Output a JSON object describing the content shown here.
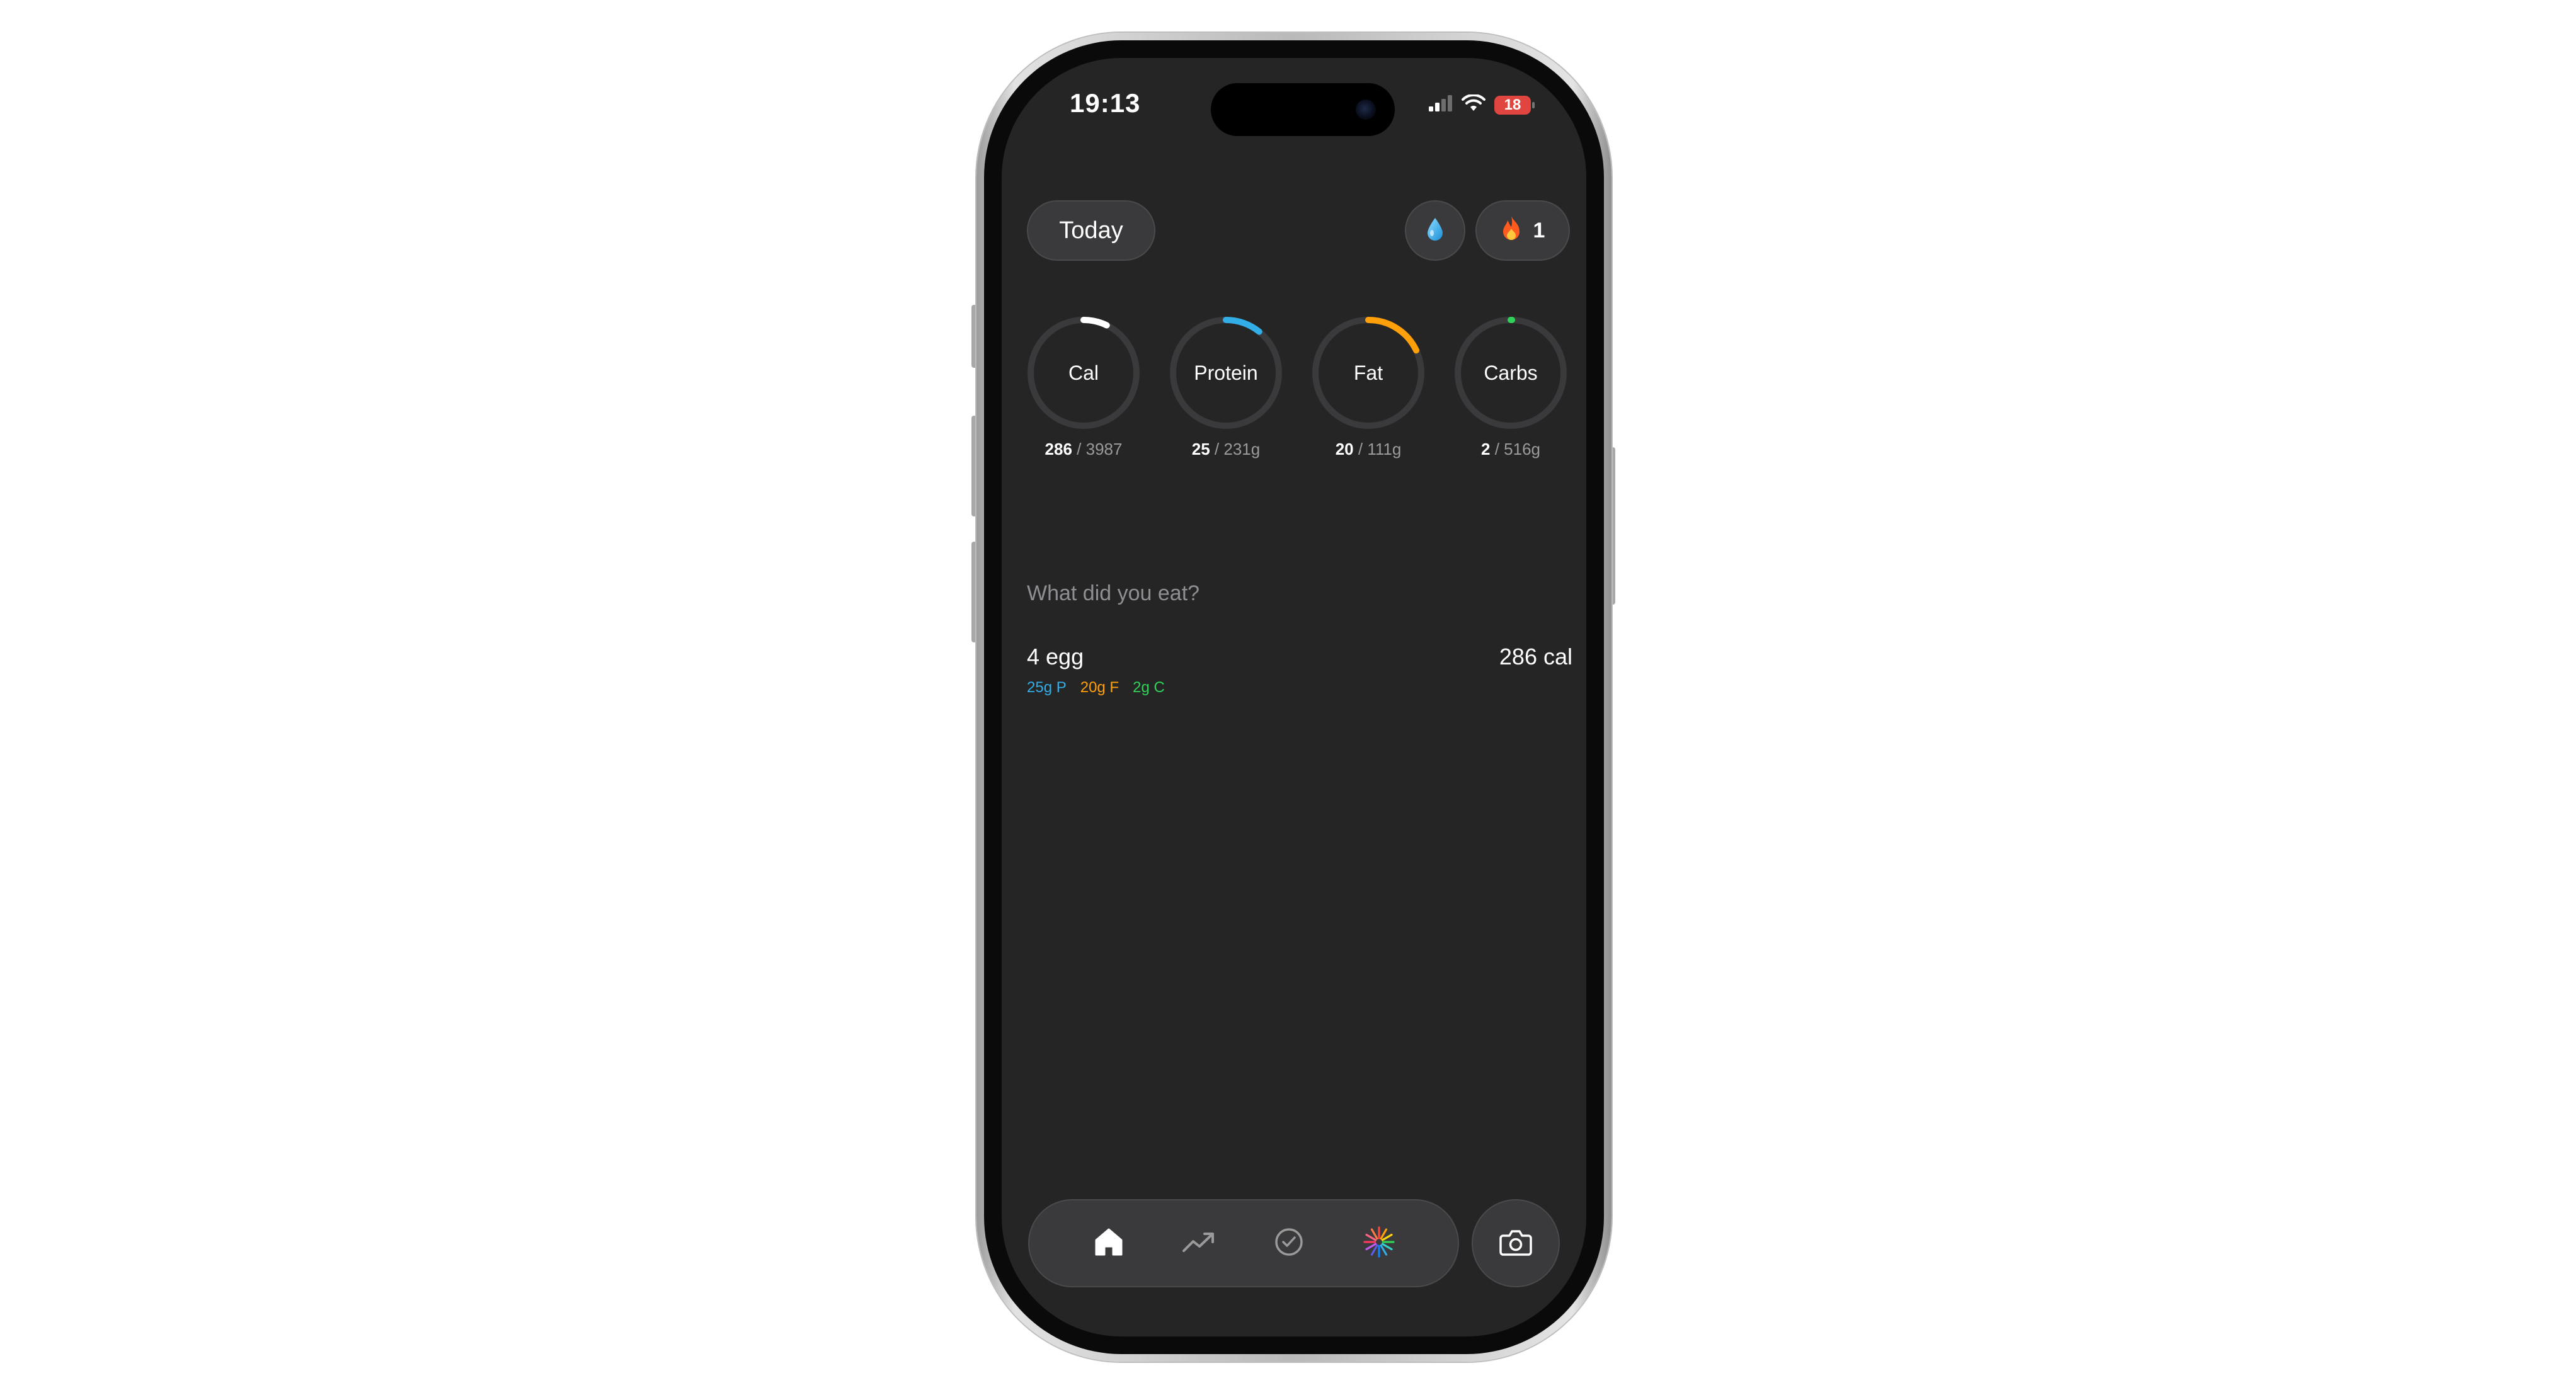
{
  "status_bar": {
    "time": "19:13",
    "battery": "18"
  },
  "header": {
    "today_label": "Today",
    "water_icon": "water-drop-icon",
    "streak_icon": "fire-icon",
    "streak_count": "1"
  },
  "macros": [
    {
      "label": "Cal",
      "current": "286",
      "goal": "3987",
      "color": "#ffffff",
      "progress": 0.072
    },
    {
      "label": "Protein",
      "current": "25",
      "goal": "231g",
      "color": "#32ade6",
      "progress": 0.108
    },
    {
      "label": "Fat",
      "current": "20",
      "goal": "111g",
      "color": "#ff9f0a",
      "progress": 0.18
    },
    {
      "label": "Carbs",
      "current": "2",
      "goal": "516g",
      "color": "#30d158",
      "progress": 0.004
    }
  ],
  "food_input": {
    "placeholder": "What did you eat?"
  },
  "food_entries": [
    {
      "name": "4 egg",
      "calories": "286 cal",
      "protein": "25g P",
      "fat": "20g F",
      "carbs": "2g C"
    }
  ],
  "colors": {
    "background": "#252525",
    "surface": "#3a3a3c",
    "protein": "#32ade6",
    "fat": "#ff9f0a",
    "carbs": "#30d158",
    "ring_track": "#3a3a3c"
  },
  "bottom_nav": {
    "items": [
      {
        "icon": "home-icon",
        "active": true
      },
      {
        "icon": "trend-chart-icon",
        "active": false
      },
      {
        "icon": "checkmark-circle-icon",
        "active": false
      },
      {
        "icon": "ai-sparkle-icon",
        "active": false
      }
    ],
    "camera_icon": "camera-icon"
  }
}
